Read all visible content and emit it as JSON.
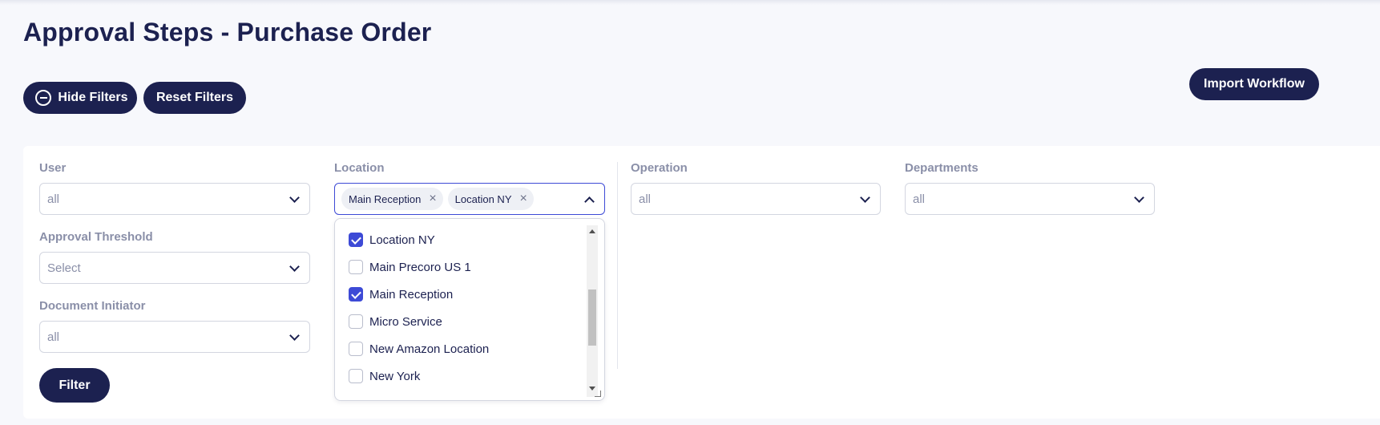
{
  "page": {
    "title": "Approval Steps - Purchase Order"
  },
  "toolbar": {
    "hide_filters_label": "Hide Filters",
    "reset_filters_label": "Reset Filters",
    "import_workflow_label": "Import Workflow"
  },
  "filters": {
    "user": {
      "label": "User",
      "value": "all"
    },
    "location": {
      "label": "Location",
      "selected_tags": [
        "Main Reception",
        "Location NY"
      ],
      "options": [
        {
          "label": "Location NY",
          "checked": true
        },
        {
          "label": "Main Precoro US 1",
          "checked": false
        },
        {
          "label": "Main Reception",
          "checked": true
        },
        {
          "label": "Micro Service",
          "checked": false
        },
        {
          "label": "New Amazon Location",
          "checked": false
        },
        {
          "label": "New York",
          "checked": false
        }
      ]
    },
    "operation": {
      "label": "Operation",
      "value": "all"
    },
    "departments": {
      "label": "Departments",
      "value": "all"
    },
    "approval_threshold": {
      "label": "Approval Threshold",
      "value": "Select"
    },
    "document_initiator": {
      "label": "Document Initiator",
      "value": "all"
    },
    "filter_button_label": "Filter"
  },
  "colors": {
    "navy": "#1c2150",
    "accent": "#3d4ad6",
    "label_gray": "#8a8fa8"
  }
}
